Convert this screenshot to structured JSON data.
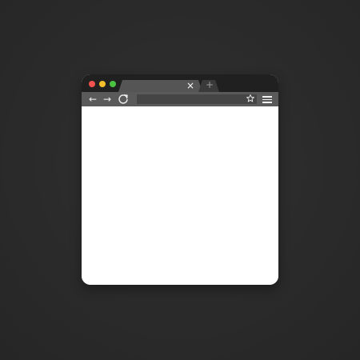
{
  "window": {
    "traffic_lights": [
      {
        "name": "close",
        "color": "#f0524f"
      },
      {
        "name": "minimize",
        "color": "#f5be2c"
      },
      {
        "name": "maximize",
        "color": "#4bc23f"
      }
    ],
    "tabs": {
      "active_title": "",
      "active_close_glyph": "×",
      "new_tab_glyph": "+"
    },
    "toolbar": {
      "back_glyph": "←",
      "forward_glyph": "→",
      "reload_icon": "reload-icon",
      "address_value": "",
      "bookmark_icon": "star-outline-icon",
      "menu_icon": "hamburger-menu-icon"
    },
    "content": {
      "text": ""
    }
  }
}
